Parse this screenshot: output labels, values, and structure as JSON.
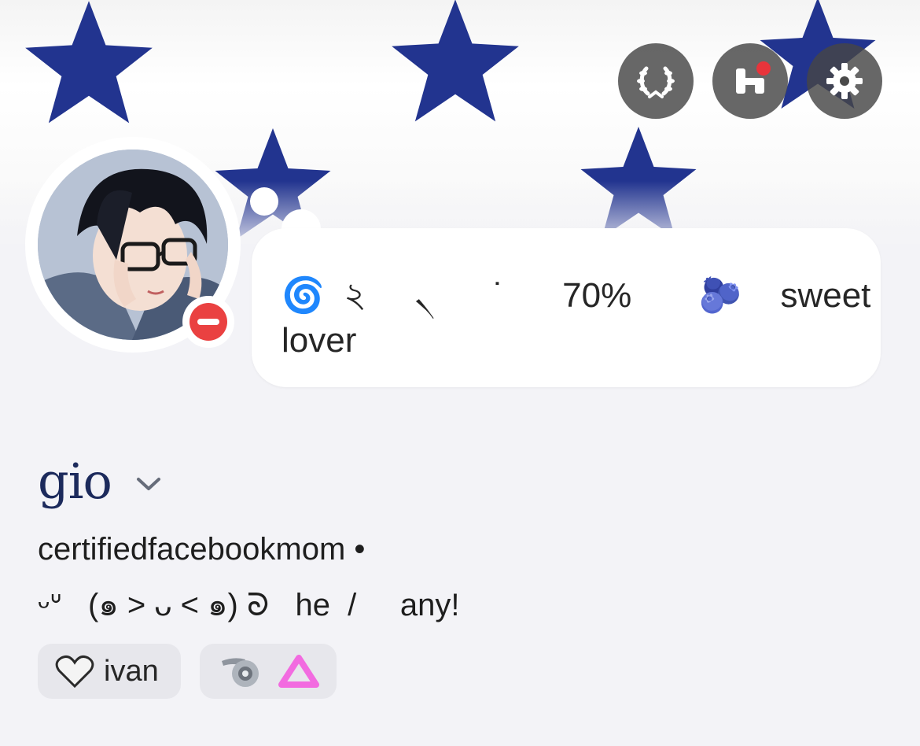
{
  "header": {
    "buttons": [
      {
        "name": "laurel-wreath-icon"
      },
      {
        "name": "shop-icon",
        "has_notification": true
      },
      {
        "name": "gear-icon"
      }
    ],
    "banner_background": "white fabric with blue stars"
  },
  "profile": {
    "avatar": "anime character with dark hair and glasses",
    "status": "do-not-disturb",
    "custom_status": {
      "line1": "🌀  ২     ৲      ˙      70%       🫐    sweet",
      "line2": "lover"
    },
    "display_name": "gio",
    "username_line": "certifiedfacebookmom •",
    "pronouns_line": "ᵕᐡ   (๑ > ᴗ < ๑) ᘐ   he  /     any!",
    "tags": [
      {
        "icon": "white-heart-icon",
        "label": "ivan"
      },
      {
        "icon": "disc-icon",
        "label": ""
      },
      {
        "icon": "triangle-icon",
        "label": ""
      }
    ]
  },
  "colors": {
    "accent_name": "#1c2a5c",
    "dnd_red": "#ea4141",
    "notification_red": "#e8343b",
    "star_blue": "#22348f"
  }
}
